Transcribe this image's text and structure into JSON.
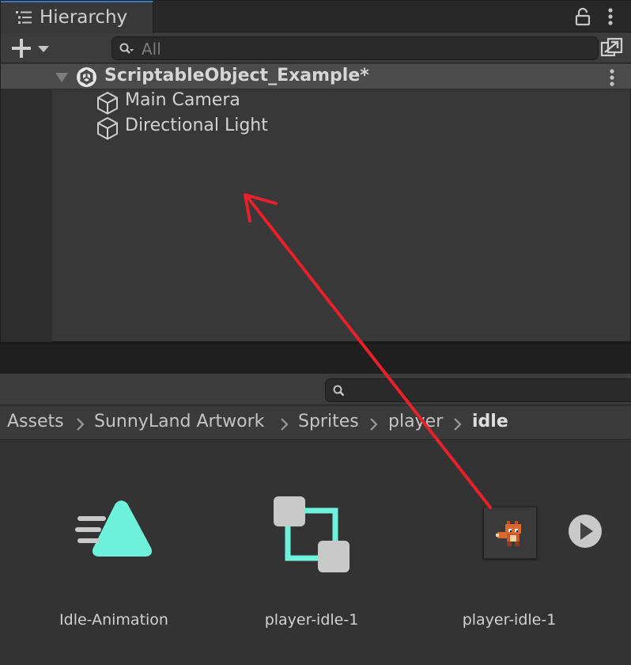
{
  "window": {
    "tab_title": "Hierarchy",
    "tab_icon": "hierarchy-list-icon",
    "lock_icon": "lock-icon",
    "menu_icon": "kebab-menu-icon"
  },
  "toolbar": {
    "create_icon": "plus-icon",
    "search_placeholder": "All",
    "search_icon": "search-icon",
    "scene_visibility_icon": "scene-visibility-icon"
  },
  "scene": {
    "name": "ScriptableObject_Example*",
    "icon": "unity-scene-icon",
    "expanded": true,
    "objects": [
      {
        "name": "Main Camera",
        "icon": "gameobject-cube-icon"
      },
      {
        "name": "Directional Light",
        "icon": "gameobject-cube-icon"
      }
    ]
  },
  "project": {
    "search_icon": "search-icon",
    "breadcrumb": [
      "Assets",
      "SunnyLand Artwork",
      "Sprites",
      "player",
      "idle"
    ],
    "assets": [
      {
        "label": "Idle-Animation",
        "icon": "animation-clip-icon"
      },
      {
        "label": "player-idle-1",
        "icon": "animator-controller-icon"
      },
      {
        "label": "player-idle-1",
        "icon": "sprite-thumbnail-fox"
      }
    ],
    "play_icon": "play-icon"
  },
  "colors": {
    "accent_tab": "#3a79bb",
    "asset_teal": "#6ff2dc",
    "annotation_red": "#e8202a"
  }
}
